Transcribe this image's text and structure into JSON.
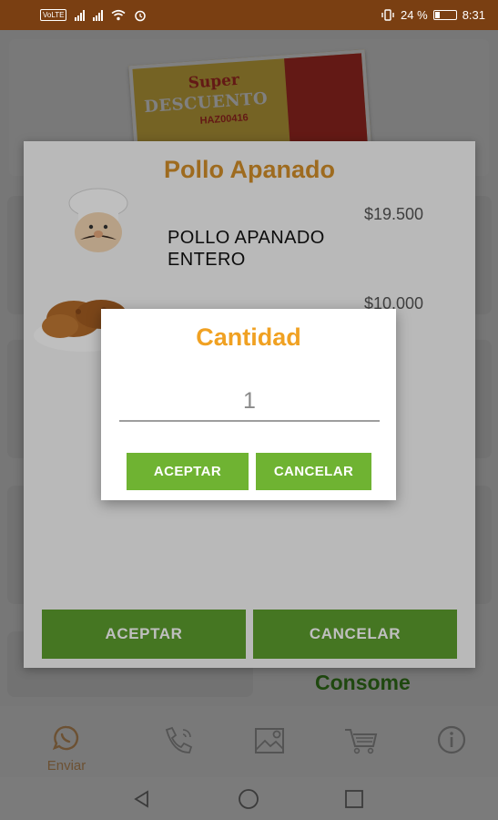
{
  "status_bar": {
    "volte_badge": "VoLTE",
    "battery_percent": "24 %",
    "battery_level": 0.24,
    "time": "8:31",
    "icons": [
      "signal-icon",
      "signal-icon",
      "wifi-icon",
      "alarm-icon",
      "vibrate-icon",
      "battery-icon"
    ]
  },
  "banner": {
    "line1": "Super",
    "line2": "DESCUENTO",
    "code": "HAZ00416"
  },
  "background": {
    "visible_item": "Consome"
  },
  "bottom_nav": {
    "items": [
      {
        "label": "Enviar",
        "icon": "whatsapp-icon"
      },
      {
        "label": "",
        "icon": "phone-icon"
      },
      {
        "label": "",
        "icon": "map-icon"
      },
      {
        "label": "",
        "icon": "cart-icon"
      },
      {
        "label": "",
        "icon": "info-icon"
      }
    ]
  },
  "product_dialog": {
    "title": "Pollo Apanado",
    "items": [
      {
        "name_line1": "POLLO APANADO",
        "name_line2": "ENTERO",
        "price": "$19.500",
        "image": "chef-icon"
      },
      {
        "price": "$10.000",
        "image": "fried-chicken-image"
      }
    ],
    "accept_label": "ACEPTAR",
    "cancel_label": "CANCELAR"
  },
  "quantity_dialog": {
    "title": "Cantidad",
    "value": "1",
    "accept_label": "ACEPTAR",
    "cancel_label": "CANCELAR"
  },
  "colors": {
    "status_bar": "#7a3f12",
    "title_orange": "#d38f2a",
    "dialog_title_orange": "#f0a122",
    "button_green": "#6fb332",
    "button_dark_green": "#5c9e2e",
    "consome_green": "#3f8f1f"
  }
}
